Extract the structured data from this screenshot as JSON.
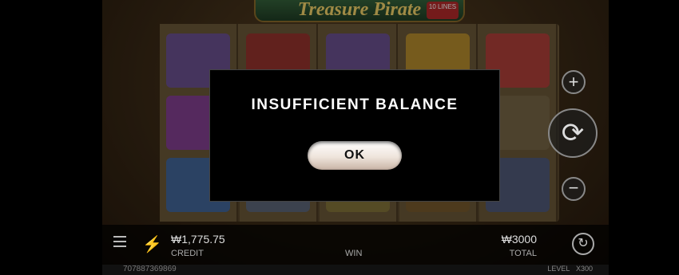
{
  "game": {
    "title": "Treasure Pirate",
    "lines_badge": "10 LINES"
  },
  "colors": {
    "accent_gold": "#f5d46a",
    "dialog_bg": "#000000",
    "ok_button": "#efe5dc"
  },
  "bottom_bar": {
    "credit_value": "₩1,775.75",
    "credit_label": "CREDIT",
    "win_label": "WIN",
    "total_value": "₩3000",
    "total_label": "TOTAL"
  },
  "footer": {
    "session_id": "707887369869",
    "level_label": "LEVEL",
    "level_value": "X300"
  },
  "controls": {
    "plus_icon": "+",
    "minus_icon": "−",
    "spin_icon": "⟳"
  },
  "dialog": {
    "message": "INSUFFICIENT BALANCE",
    "ok_label": "OK"
  }
}
